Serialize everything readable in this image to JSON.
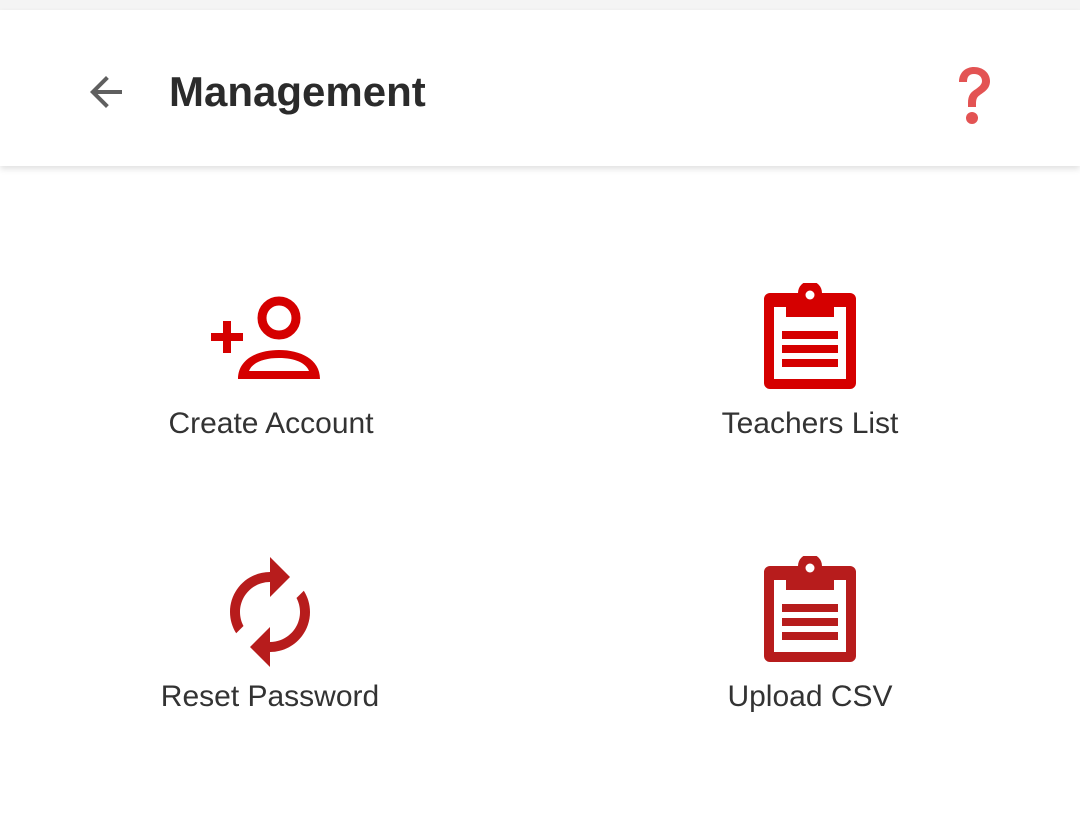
{
  "header": {
    "title": "Management",
    "back_icon": "arrow-left-icon",
    "help_icon": "question-mark-icon"
  },
  "colors": {
    "accent": "#d50000",
    "accent_dark": "#b71c1c",
    "help": "#e35353",
    "title_text": "#2b2b2b",
    "label_text": "#333333"
  },
  "menu": {
    "items": [
      {
        "label": "Create Account",
        "icon": "person-add-icon"
      },
      {
        "label": "Teachers List",
        "icon": "clipboard-icon"
      },
      {
        "label": "Reset Password",
        "icon": "sync-icon"
      },
      {
        "label": "Upload CSV",
        "icon": "clipboard-icon"
      }
    ]
  }
}
